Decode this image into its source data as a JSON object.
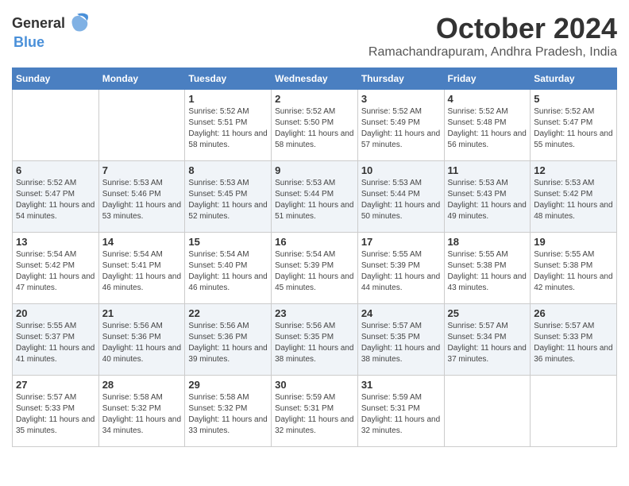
{
  "header": {
    "logo_general": "General",
    "logo_blue": "Blue",
    "month_title": "October 2024",
    "location": "Ramachandrapuram, Andhra Pradesh, India"
  },
  "days_of_week": [
    "Sunday",
    "Monday",
    "Tuesday",
    "Wednesday",
    "Thursday",
    "Friday",
    "Saturday"
  ],
  "weeks": [
    [
      {
        "day": "",
        "sunrise": "",
        "sunset": "",
        "daylight": ""
      },
      {
        "day": "",
        "sunrise": "",
        "sunset": "",
        "daylight": ""
      },
      {
        "day": "1",
        "sunrise": "Sunrise: 5:52 AM",
        "sunset": "Sunset: 5:51 PM",
        "daylight": "Daylight: 11 hours and 58 minutes."
      },
      {
        "day": "2",
        "sunrise": "Sunrise: 5:52 AM",
        "sunset": "Sunset: 5:50 PM",
        "daylight": "Daylight: 11 hours and 58 minutes."
      },
      {
        "day": "3",
        "sunrise": "Sunrise: 5:52 AM",
        "sunset": "Sunset: 5:49 PM",
        "daylight": "Daylight: 11 hours and 57 minutes."
      },
      {
        "day": "4",
        "sunrise": "Sunrise: 5:52 AM",
        "sunset": "Sunset: 5:48 PM",
        "daylight": "Daylight: 11 hours and 56 minutes."
      },
      {
        "day": "5",
        "sunrise": "Sunrise: 5:52 AM",
        "sunset": "Sunset: 5:47 PM",
        "daylight": "Daylight: 11 hours and 55 minutes."
      }
    ],
    [
      {
        "day": "6",
        "sunrise": "Sunrise: 5:52 AM",
        "sunset": "Sunset: 5:47 PM",
        "daylight": "Daylight: 11 hours and 54 minutes."
      },
      {
        "day": "7",
        "sunrise": "Sunrise: 5:53 AM",
        "sunset": "Sunset: 5:46 PM",
        "daylight": "Daylight: 11 hours and 53 minutes."
      },
      {
        "day": "8",
        "sunrise": "Sunrise: 5:53 AM",
        "sunset": "Sunset: 5:45 PM",
        "daylight": "Daylight: 11 hours and 52 minutes."
      },
      {
        "day": "9",
        "sunrise": "Sunrise: 5:53 AM",
        "sunset": "Sunset: 5:44 PM",
        "daylight": "Daylight: 11 hours and 51 minutes."
      },
      {
        "day": "10",
        "sunrise": "Sunrise: 5:53 AM",
        "sunset": "Sunset: 5:44 PM",
        "daylight": "Daylight: 11 hours and 50 minutes."
      },
      {
        "day": "11",
        "sunrise": "Sunrise: 5:53 AM",
        "sunset": "Sunset: 5:43 PM",
        "daylight": "Daylight: 11 hours and 49 minutes."
      },
      {
        "day": "12",
        "sunrise": "Sunrise: 5:53 AM",
        "sunset": "Sunset: 5:42 PM",
        "daylight": "Daylight: 11 hours and 48 minutes."
      }
    ],
    [
      {
        "day": "13",
        "sunrise": "Sunrise: 5:54 AM",
        "sunset": "Sunset: 5:42 PM",
        "daylight": "Daylight: 11 hours and 47 minutes."
      },
      {
        "day": "14",
        "sunrise": "Sunrise: 5:54 AM",
        "sunset": "Sunset: 5:41 PM",
        "daylight": "Daylight: 11 hours and 46 minutes."
      },
      {
        "day": "15",
        "sunrise": "Sunrise: 5:54 AM",
        "sunset": "Sunset: 5:40 PM",
        "daylight": "Daylight: 11 hours and 46 minutes."
      },
      {
        "day": "16",
        "sunrise": "Sunrise: 5:54 AM",
        "sunset": "Sunset: 5:39 PM",
        "daylight": "Daylight: 11 hours and 45 minutes."
      },
      {
        "day": "17",
        "sunrise": "Sunrise: 5:55 AM",
        "sunset": "Sunset: 5:39 PM",
        "daylight": "Daylight: 11 hours and 44 minutes."
      },
      {
        "day": "18",
        "sunrise": "Sunrise: 5:55 AM",
        "sunset": "Sunset: 5:38 PM",
        "daylight": "Daylight: 11 hours and 43 minutes."
      },
      {
        "day": "19",
        "sunrise": "Sunrise: 5:55 AM",
        "sunset": "Sunset: 5:38 PM",
        "daylight": "Daylight: 11 hours and 42 minutes."
      }
    ],
    [
      {
        "day": "20",
        "sunrise": "Sunrise: 5:55 AM",
        "sunset": "Sunset: 5:37 PM",
        "daylight": "Daylight: 11 hours and 41 minutes."
      },
      {
        "day": "21",
        "sunrise": "Sunrise: 5:56 AM",
        "sunset": "Sunset: 5:36 PM",
        "daylight": "Daylight: 11 hours and 40 minutes."
      },
      {
        "day": "22",
        "sunrise": "Sunrise: 5:56 AM",
        "sunset": "Sunset: 5:36 PM",
        "daylight": "Daylight: 11 hours and 39 minutes."
      },
      {
        "day": "23",
        "sunrise": "Sunrise: 5:56 AM",
        "sunset": "Sunset: 5:35 PM",
        "daylight": "Daylight: 11 hours and 38 minutes."
      },
      {
        "day": "24",
        "sunrise": "Sunrise: 5:57 AM",
        "sunset": "Sunset: 5:35 PM",
        "daylight": "Daylight: 11 hours and 38 minutes."
      },
      {
        "day": "25",
        "sunrise": "Sunrise: 5:57 AM",
        "sunset": "Sunset: 5:34 PM",
        "daylight": "Daylight: 11 hours and 37 minutes."
      },
      {
        "day": "26",
        "sunrise": "Sunrise: 5:57 AM",
        "sunset": "Sunset: 5:33 PM",
        "daylight": "Daylight: 11 hours and 36 minutes."
      }
    ],
    [
      {
        "day": "27",
        "sunrise": "Sunrise: 5:57 AM",
        "sunset": "Sunset: 5:33 PM",
        "daylight": "Daylight: 11 hours and 35 minutes."
      },
      {
        "day": "28",
        "sunrise": "Sunrise: 5:58 AM",
        "sunset": "Sunset: 5:32 PM",
        "daylight": "Daylight: 11 hours and 34 minutes."
      },
      {
        "day": "29",
        "sunrise": "Sunrise: 5:58 AM",
        "sunset": "Sunset: 5:32 PM",
        "daylight": "Daylight: 11 hours and 33 minutes."
      },
      {
        "day": "30",
        "sunrise": "Sunrise: 5:59 AM",
        "sunset": "Sunset: 5:31 PM",
        "daylight": "Daylight: 11 hours and 32 minutes."
      },
      {
        "day": "31",
        "sunrise": "Sunrise: 5:59 AM",
        "sunset": "Sunset: 5:31 PM",
        "daylight": "Daylight: 11 hours and 32 minutes."
      },
      {
        "day": "",
        "sunrise": "",
        "sunset": "",
        "daylight": ""
      },
      {
        "day": "",
        "sunrise": "",
        "sunset": "",
        "daylight": ""
      }
    ]
  ]
}
